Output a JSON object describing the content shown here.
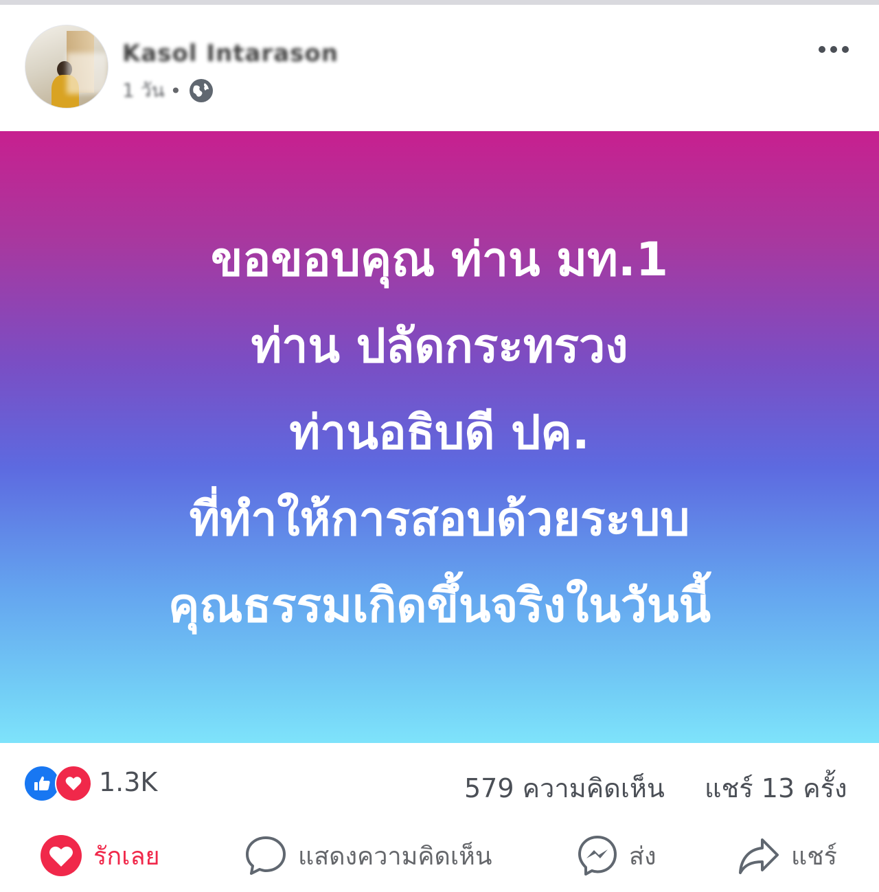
{
  "post": {
    "author_name": "Kasol Intarason",
    "time": "1 วัน",
    "dot": "•",
    "icons": {
      "privacy": "globe-icon",
      "more": "more-options-icon"
    },
    "background": {
      "top": "#c7208f",
      "middle": "#5d6ae0",
      "bottom": "#7ee3fb"
    },
    "lines": [
      "ขอขอบคุณ ท่าน มท.1",
      "ท่าน ปลัดกระทรวง",
      "ท่านอธิบดี ปค.",
      "ที่ทำให้การสอบด้วยระบบ",
      "คุณธรรมเกิดขึ้นจริงในวันนี้"
    ]
  },
  "stats": {
    "reactions": "1.3K",
    "reaction_icons": [
      "like-icon",
      "love-icon"
    ],
    "comments": "579 ความคิดเห็น",
    "shares": "แชร์ 13 ครั้ง"
  },
  "actions": {
    "love": {
      "label": "รักเลย",
      "icon": "heart-icon",
      "color": "#f0284a"
    },
    "comment": {
      "label": "แสดงความคิดเห็น",
      "icon": "comment-bubble-icon"
    },
    "send": {
      "label": "ส่ง",
      "icon": "messenger-icon"
    },
    "share": {
      "label": "แชร์",
      "icon": "share-arrow-icon"
    }
  }
}
